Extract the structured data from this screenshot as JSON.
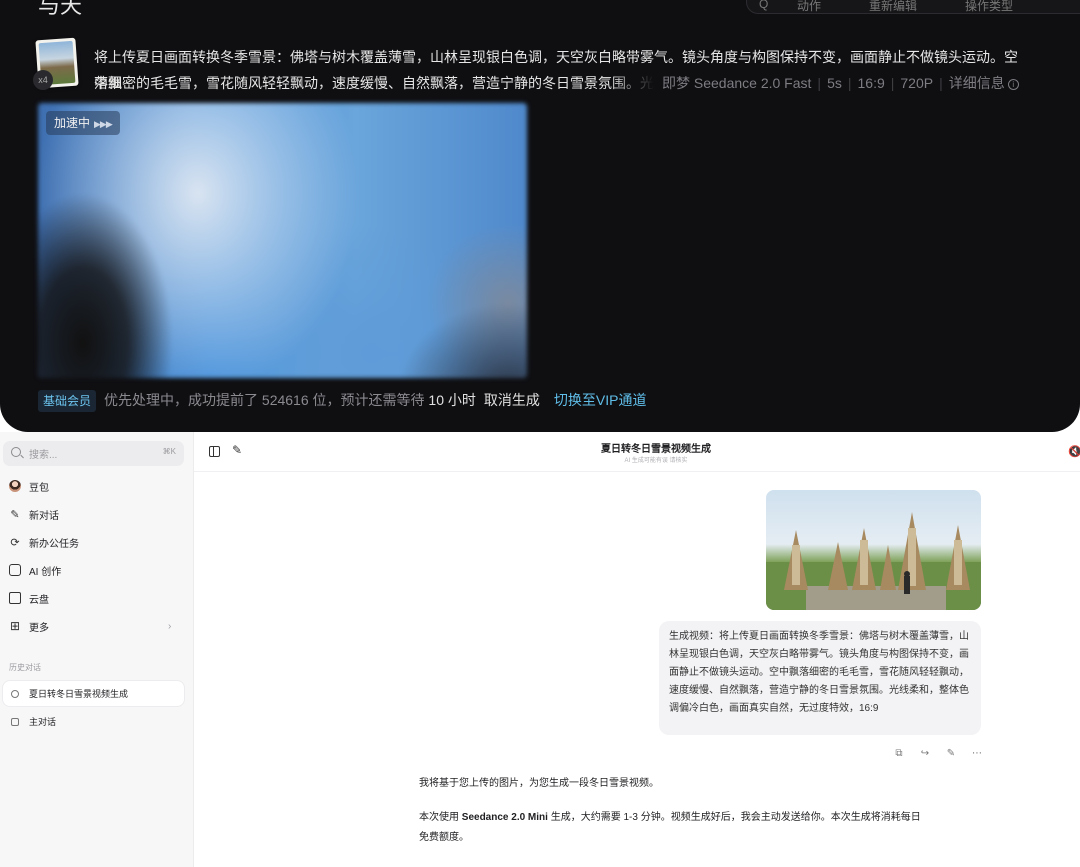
{
  "top_panel": {
    "corner_fragment": "与天",
    "pill_items": [
      "Q",
      "动作",
      "重新编辑",
      "操作类型",
      ""
    ],
    "thumb_badge": "x4",
    "prompt_line1": "将上传夏日画面转换冬季雪景：佛塔与树木覆盖薄雪，山林呈现银白色调，天空灰白略带雾气。镜头角度与构图保持不变，画面静止不做镜头运动。空中飘",
    "prompt_line2": "落细密的毛毛雪，雪花随风轻轻飘动，速度缓慢、自然飘落，营造宁静的冬日雪景氛围。光线",
    "meta": {
      "model": "即梦 Seedance 2.0 Fast",
      "duration": "5s",
      "ratio": "16:9",
      "resolution": "720P",
      "details": "详细信息"
    },
    "accel_label": "加速中",
    "status": {
      "member": "基础会员",
      "text_before": "优先处理中，成功提前了 524616 位，预计还需等待",
      "hours": "10",
      "text_after": "小时",
      "cancel": "取消生成",
      "vip": "切换至VIP通道"
    }
  },
  "sidebar": {
    "search_placeholder": "搜索...",
    "search_shortcut": "⌘K",
    "items": [
      {
        "label": "豆包",
        "icon": "avatar-icon"
      },
      {
        "label": "新对话",
        "icon": "edit-icon"
      },
      {
        "label": "新办公任务",
        "icon": "office-task-icon"
      },
      {
        "label": "AI 创作",
        "icon": "image-create-icon"
      },
      {
        "label": "云盘",
        "icon": "folder-icon"
      },
      {
        "label": "更多",
        "icon": "grid-icon"
      }
    ],
    "history_label": "历史对话",
    "history": [
      {
        "label": "夏日转冬日雪景视频生成"
      },
      {
        "label": "主对话"
      }
    ]
  },
  "chat": {
    "title": "夏日转冬日雪景视频生成",
    "subtitle": "AI 生成可能有误 请核实",
    "user_message": "生成视频：将上传夏日画面转换冬季雪景：佛塔与树木覆盖薄雪，山林呈现银白色调，天空灰白略带雾气。镜头角度与构图保持不变，画面静止不做镜头运动。空中飘落细密的毛毛雪，雪花随风轻轻飘动，速度缓慢、自然飘落，营造宁静的冬日雪景氛围。光线柔和，整体色调偏冷白色，画面真实自然，无过度特效，16:9",
    "ai_line1": "我将基于您上传的图片，为您生成一段冬日雪景视频。",
    "ai_line2_prefix": "本次使用",
    "ai_line2_model": "Seedance 2.0 Mini",
    "ai_line2_suffix": "生成，大约需要 1-3 分钟。视频生成好后，我会主动发送给你。本次生成将消耗每日",
    "ai_line3": "免费额度。"
  },
  "colors": {
    "dark_bg": "#0f0f12",
    "vip_blue": "#5fbde8",
    "sidebar_bg": "#f7f7f8",
    "bubble_bg": "#f3f3f5"
  }
}
